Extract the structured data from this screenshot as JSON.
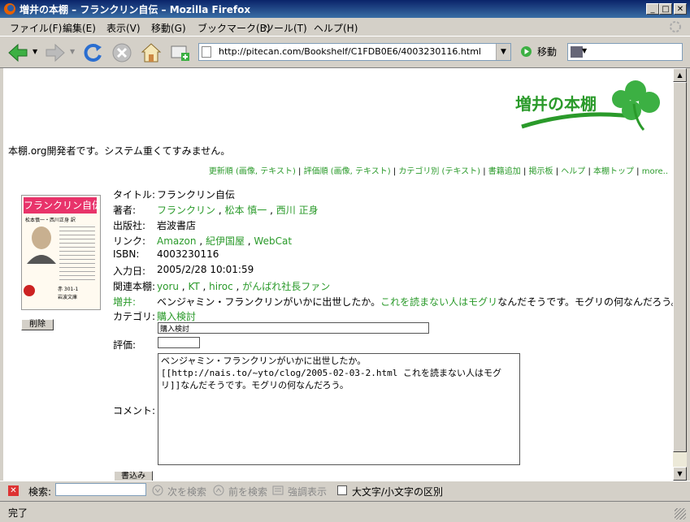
{
  "window": {
    "title": "増井の本棚 – フランクリン自伝 – Mozilla Firefox"
  },
  "menu": [
    "ファイル(F)",
    "編集(E)",
    "表示(V)",
    "移動(G)",
    "ブックマーク(B)",
    "ツール(T)",
    "ヘルプ(H)"
  ],
  "toolbar": {
    "url": "http://pitecan.com/Bookshelf/C1FDB0E6/4003230116.html",
    "go_label": "移動"
  },
  "site": {
    "logo_text": "増井の本棚",
    "notice": "本棚.org開発者です。システム重くてすみません。"
  },
  "nav_links": [
    "更新順 (画像, テキスト)",
    "評価順 (画像, テキスト)",
    "カテゴリ別 (テキスト)",
    "書籍追加",
    "掲示板",
    "ヘルプ",
    "本棚トップ",
    "more.."
  ],
  "book": {
    "cover_title": "フランクリン自伝",
    "cover_sub": "松本慎一・西川正身 訳",
    "cover_bottom": "岩波文庫",
    "cover_num": "赤 301-1",
    "labels": {
      "title": "タイトル:",
      "author": "著者:",
      "publisher": "出版社:",
      "link": "リンク:",
      "isbn": "ISBN:",
      "date": "入力日:",
      "related": "関連本棚:",
      "user": "増井:",
      "category": "カテゴリ:",
      "rating": "評価:",
      "comment": "コメント:"
    },
    "title": "フランクリン自伝",
    "authors": [
      "フランクリン",
      "松本 慎一",
      "西川 正身"
    ],
    "publisher": "岩波書店",
    "links": [
      "Amazon",
      "紀伊国屋",
      "WebCat"
    ],
    "isbn": "4003230116",
    "date": "2005/2/28 10:01:59",
    "related": [
      "yoru",
      "KT",
      "hiroc",
      "がんばれ社長ファン"
    ],
    "user_comment_pre": "ベンジャミン・フランクリンがいかに出世したか。",
    "user_comment_link": "これを読まない人はモグリ",
    "user_comment_post": "なんだそうです。モグリの何なんだろう。",
    "category_link": "購入検討",
    "category_input": "購入検討",
    "rating_input": "",
    "comment_text": "ベンジャミン・フランクリンがいかに出世したか。\n[[http://nais.to/~yto/clog/2005-02-03-2.html これを読まない人はモグリ]]なんだそうです。モグリの何なんだろう。",
    "delete_label": "削除",
    "submit_label": "書込み"
  },
  "findbar": {
    "label": "検索:",
    "next": "次を検索",
    "prev": "前を検索",
    "highlight": "強調表示",
    "match_case": "大文字/小文字の区別"
  },
  "status": {
    "text": "完了"
  }
}
